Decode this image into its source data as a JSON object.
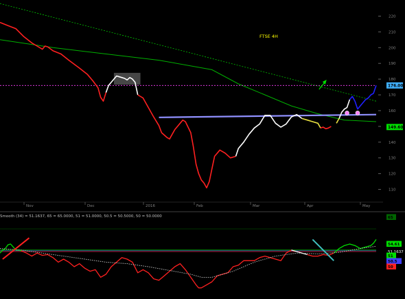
{
  "chart_data": [
    {
      "type": "candlestick",
      "title": "FTSE 4H",
      "ylim": [
        105,
        225
      ],
      "y_ticks": [
        110,
        120,
        130,
        140,
        150,
        160,
        170,
        180,
        190,
        200,
        210,
        220
      ],
      "x_ticks": [
        "Nov",
        "Dec",
        "2016",
        "Feb",
        "Mar",
        "Apr",
        "May"
      ],
      "price_labels": [
        {
          "text": "176.00",
          "value": 176.0,
          "color": "#40b0ff"
        },
        {
          "text": "149.60",
          "value": 149.6,
          "color": "#00e000"
        }
      ],
      "series": [
        {
          "name": "",
          "color": "#ff2020",
          "points": [
            [
              0,
              216
            ],
            [
              1.5,
              214
            ],
            [
              3,
              212
            ],
            [
              4.5,
              207
            ],
            [
              6,
              203
            ],
            [
              7,
              201
            ],
            [
              8,
              199
            ],
            [
              8.5,
              201
            ],
            [
              9,
              200.5
            ],
            [
              10,
              198
            ],
            [
              11.5,
              196
            ],
            [
              13,
              192
            ],
            [
              15,
              187
            ],
            [
              16.5,
              183
            ],
            [
              17.5,
              179
            ],
            [
              18.5,
              174.5
            ],
            [
              19,
              168.5
            ],
            [
              19.5,
              166
            ],
            [
              20,
              171.5
            ]
          ]
        },
        {
          "name": "",
          "color": "#ffffff",
          "points": [
            [
              20,
              171.5
            ],
            [
              20.5,
              176
            ],
            [
              21.5,
              180
            ],
            [
              22,
              182
            ],
            [
              22.5,
              181.5
            ],
            [
              23,
              181
            ],
            [
              23.5,
              180.5
            ],
            [
              24,
              179.5
            ],
            [
              24.5,
              181
            ],
            [
              25,
              180
            ],
            [
              25.5,
              178
            ],
            [
              26,
              170
            ]
          ]
        },
        {
          "name": "",
          "color": "#ff2020",
          "points": [
            [
              26,
              170
            ],
            [
              27,
              168
            ],
            [
              28,
              162
            ],
            [
              29,
              156
            ],
            [
              30,
              150.5
            ],
            [
              30.5,
              146
            ],
            [
              31.5,
              143
            ],
            [
              32,
              142
            ],
            [
              33,
              148
            ],
            [
              34,
              152
            ],
            [
              34.5,
              154
            ],
            [
              35,
              153
            ],
            [
              36,
              146
            ],
            [
              36.5,
              137
            ],
            [
              37,
              126
            ],
            [
              37.5,
              120
            ],
            [
              38,
              116
            ],
            [
              38.5,
              114
            ],
            [
              39,
              111
            ],
            [
              39.5,
              115
            ],
            [
              40,
              123
            ],
            [
              40.5,
              131
            ],
            [
              41.5,
              135
            ],
            [
              42.5,
              133
            ],
            [
              43.5,
              130
            ],
            [
              44.5,
              131
            ]
          ]
        },
        {
          "name": "",
          "color": "#ffffff",
          "points": [
            [
              44.5,
              131
            ],
            [
              45,
              136
            ],
            [
              46,
              140
            ],
            [
              47,
              145
            ],
            [
              48,
              149
            ],
            [
              49,
              151.5
            ],
            [
              50,
              157
            ],
            [
              51,
              157
            ],
            [
              52,
              152
            ],
            [
              53,
              149.5
            ],
            [
              54,
              151.5
            ],
            [
              55,
              156
            ],
            [
              56,
              157.5
            ],
            [
              57,
              155
            ]
          ]
        },
        {
          "name": "",
          "color": "#e8e040",
          "points": [
            [
              57,
              155
            ],
            [
              58,
              154
            ],
            [
              59,
              153
            ],
            [
              60,
              152
            ],
            [
              60.5,
              149
            ]
          ]
        },
        {
          "name": "",
          "color": "#ff2020",
          "points": [
            [
              60.5,
              149
            ],
            [
              61,
              149.5
            ],
            [
              61.5,
              148.5
            ],
            [
              62,
              149
            ],
            [
              62.5,
              150
            ]
          ]
        },
        {
          "name": "",
          "color": "#e8e040",
          "points": [
            [
              63.5,
              152
            ],
            [
              64,
              155
            ]
          ]
        },
        {
          "name": "",
          "color": "#ffffff",
          "points": [
            [
              64,
              155
            ],
            [
              64.5,
              159
            ],
            [
              65,
              161
            ],
            [
              65.5,
              162
            ],
            [
              66,
              167
            ]
          ]
        },
        {
          "name": "",
          "color": "#2020ff",
          "points": [
            [
              66,
              167
            ],
            [
              66.5,
              169
            ],
            [
              67,
              166
            ],
            [
              67.5,
              161
            ],
            [
              68,
              163
            ],
            [
              68.5,
              165
            ],
            [
              69,
              167
            ],
            [
              69.5,
              168
            ],
            [
              70,
              170
            ],
            [
              70.5,
              171
            ],
            [
              71,
              176
            ]
          ]
        }
      ],
      "ma_long": [
        [
          0,
          205
        ],
        [
          10,
          200
        ],
        [
          20,
          196
        ],
        [
          30,
          192
        ],
        [
          40,
          186
        ],
        [
          45,
          177
        ],
        [
          50,
          170
        ],
        [
          55,
          163
        ],
        [
          60,
          158
        ],
        [
          65,
          154
        ],
        [
          71,
          153
        ]
      ],
      "trendline": [
        [
          0,
          228
        ],
        [
          71,
          166
        ]
      ],
      "neckline": [
        [
          30,
          155.7
        ],
        [
          71,
          157.5
        ]
      ],
      "resistance_level": 176,
      "box": {
        "x": [
          21.5,
          26.5
        ],
        "y": [
          176.5,
          184
        ]
      },
      "markers": [
        {
          "x": 65.5,
          "y": 158.5
        },
        {
          "x": 67.5,
          "y": 158.5
        }
      ],
      "arrow": {
        "x": 61,
        "y": 177
      }
    },
    {
      "type": "line",
      "title": "Smooth (34) = 51.1637, 65 = 65.0000, 51 = 51.0000, 50.5 = 50.5000, 50 = 50.0000",
      "indicator_name": "Smooth (34)",
      "levels": [
        {
          "name": "65",
          "value": 65,
          "color": "#00c000"
        },
        {
          "name": "51",
          "value": 51,
          "color": "#00e000"
        },
        {
          "name": "50.5",
          "value": 50.5,
          "color": "#4040ff"
        },
        {
          "name": "50",
          "value": 50,
          "color": "#ff2020"
        }
      ],
      "ylim": [
        20,
        70
      ],
      "right_labels": [
        {
          "text": "65",
          "value": 65,
          "color": "#00e000"
        },
        {
          "text": "54.61",
          "value": 54.6,
          "color": "#00e000"
        },
        {
          "text": "51.1637",
          "value": 51.2,
          "color": "#ffffff"
        },
        {
          "text": "51",
          "value": 51,
          "color": "#00e000"
        },
        {
          "text": "50.5",
          "value": 50.5,
          "color": "#4040ff"
        },
        {
          "text": "50",
          "value": 50,
          "color": "#ff2020"
        }
      ],
      "series": [
        {
          "name": "",
          "color": "#00e000",
          "points": [
            [
              0,
              49
            ],
            [
              0.5,
              51
            ],
            [
              1,
              52
            ],
            [
              1.5,
              54.5
            ],
            [
              2,
              55
            ],
            [
              2.5,
              53
            ],
            [
              3,
              51
            ],
            [
              3.5,
              51
            ],
            [
              4,
              50.5
            ]
          ]
        },
        {
          "name": "",
          "color": "#ff2020",
          "points": [
            [
              4,
              50.5
            ],
            [
              5,
              49
            ],
            [
              6,
              47
            ],
            [
              7,
              49
            ],
            [
              8,
              47.5
            ],
            [
              9,
              48
            ],
            [
              10,
              46
            ],
            [
              11,
              43
            ],
            [
              12,
              45
            ],
            [
              13,
              43
            ],
            [
              14,
              40
            ],
            [
              15,
              42
            ],
            [
              16,
              39
            ],
            [
              17,
              37
            ],
            [
              18,
              38
            ],
            [
              19,
              33
            ],
            [
              20,
              35
            ],
            [
              21,
              40
            ],
            [
              22,
              43
            ],
            [
              23,
              46
            ],
            [
              24,
              45
            ],
            [
              25,
              43
            ],
            [
              26,
              36
            ],
            [
              27,
              38
            ],
            [
              28,
              36
            ],
            [
              29,
              32
            ],
            [
              30,
              31
            ],
            [
              31,
              34
            ],
            [
              32,
              37
            ],
            [
              33,
              40
            ],
            [
              34,
              42
            ],
            [
              35,
              38
            ],
            [
              36,
              33
            ],
            [
              37,
              28
            ],
            [
              37.5,
              26
            ],
            [
              38,
              26
            ],
            [
              39,
              28
            ],
            [
              40,
              30
            ],
            [
              41,
              34
            ],
            [
              42,
              35
            ],
            [
              43,
              36
            ],
            [
              44,
              40
            ],
            [
              45,
              41
            ],
            [
              46,
              44
            ],
            [
              47,
              44
            ],
            [
              48,
              44
            ],
            [
              49,
              46
            ],
            [
              50,
              47
            ],
            [
              51,
              46
            ],
            [
              52,
              45
            ],
            [
              53,
              44
            ],
            [
              54,
              49
            ],
            [
              55,
              51
            ]
          ]
        },
        {
          "name": "",
          "color": "#ffffff",
          "points": [
            [
              55,
              51
            ],
            [
              56,
              50
            ],
            [
              57,
              49
            ],
            [
              58,
              48
            ]
          ]
        },
        {
          "name": "",
          "color": "#ff2020",
          "points": [
            [
              58,
              48
            ],
            [
              59,
              47
            ],
            [
              60,
              47
            ],
            [
              61,
              48
            ],
            [
              62,
              47.5
            ],
            [
              63,
              49
            ]
          ]
        },
        {
          "name": "",
          "color": "#00e000",
          "points": [
            [
              63,
              49
            ],
            [
              64,
              52
            ],
            [
              65,
              54
            ],
            [
              66,
              55
            ],
            [
              67,
              54
            ],
            [
              68,
              52
            ],
            [
              69,
              53
            ],
            [
              70,
              54
            ],
            [
              70.5,
              55.5
            ],
            [
              71,
              58
            ]
          ]
        },
        {
          "name": "",
          "color": "#c8c8c8",
          "dashed": true,
          "points": [
            [
              0,
              52
            ],
            [
              4,
              51
            ],
            [
              8,
              49
            ],
            [
              12,
              47
            ],
            [
              16,
              45
            ],
            [
              20,
              43
            ],
            [
              24,
              42
            ],
            [
              28,
              40
            ],
            [
              32,
              37.5
            ],
            [
              36,
              35
            ],
            [
              38,
              33
            ],
            [
              40,
              33
            ],
            [
              44,
              37
            ],
            [
              48,
              43
            ],
            [
              52,
              47
            ],
            [
              56,
              49
            ],
            [
              60,
              48.5
            ],
            [
              64,
              49.5
            ],
            [
              68,
              52
            ],
            [
              71,
              53.5
            ]
          ]
        }
      ],
      "annotations": [
        {
          "color": "#ff2020",
          "from": [
            0.5,
            45
          ],
          "to": [
            5.5,
            59
          ]
        },
        {
          "color": "#40c0c0",
          "from": [
            59,
            58
          ],
          "to": [
            63,
            44
          ]
        }
      ]
    }
  ]
}
